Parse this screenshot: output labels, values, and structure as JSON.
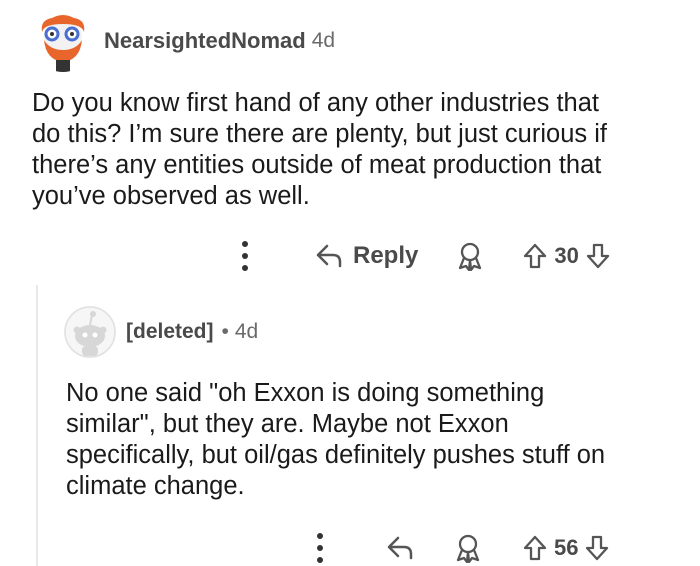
{
  "comment": {
    "username": "NearsightedNomad",
    "time": "4d",
    "body": "Do you know first hand of any other industries that\ndo this? I’m sure there are plenty, but just curious if\nthere’s any entities outside of meat production that\nyou’ve observed as well.",
    "reply_label": "Reply",
    "score": "30",
    "icons": [
      "more-vertical-icon",
      "reply-arrow-icon",
      "award-icon",
      "upvote-icon",
      "downvote-icon"
    ]
  },
  "reply": {
    "username": "[deleted]",
    "separator": "•",
    "time": "4d",
    "body": "No one said \"oh Exxon is doing something\nsimilar\", but they are. Maybe not Exxon\nspecifically, but oil/gas definitely pushes stuff on\nclimate change.",
    "score": "56",
    "icons": [
      "more-vertical-icon",
      "reply-arrow-icon",
      "award-icon",
      "upvote-icon",
      "downvote-icon"
    ]
  },
  "colors": {
    "text": "#1a1a1b",
    "meta": "#6a6a6a",
    "avatar_orange": "#e8662c",
    "avatar_grey": "#d7d7d7"
  }
}
